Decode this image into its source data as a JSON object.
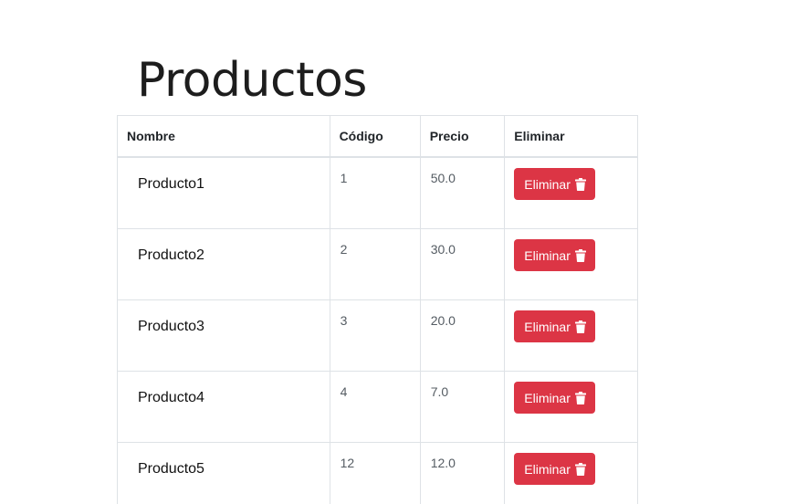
{
  "page": {
    "title": "Productos"
  },
  "table": {
    "headers": {
      "name": "Nombre",
      "code": "Código",
      "price": "Precio",
      "delete": "Eliminar"
    },
    "rows": [
      {
        "name": "Producto1",
        "code": "1",
        "price": "50.0",
        "action_label": "Eliminar"
      },
      {
        "name": "Producto2",
        "code": "2",
        "price": "30.0",
        "action_label": "Eliminar"
      },
      {
        "name": "Producto3",
        "code": "3",
        "price": "20.0",
        "action_label": "Eliminar"
      },
      {
        "name": "Producto4",
        "code": "4",
        "price": "7.0",
        "action_label": "Eliminar"
      },
      {
        "name": "Producto5",
        "code": "12",
        "price": "12.0",
        "action_label": "Eliminar"
      }
    ]
  },
  "icons": {
    "delete": "trash-icon"
  },
  "colors": {
    "danger": "#dc3545",
    "border": "#dee2e6",
    "text": "#212529"
  }
}
